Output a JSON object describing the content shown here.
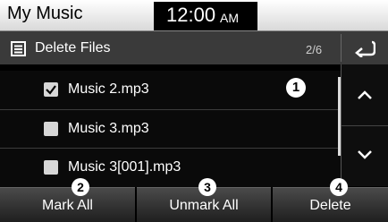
{
  "status": {
    "app_title": "My Music",
    "time": "12:00",
    "ampm": "AM"
  },
  "header": {
    "icon": "list-icon",
    "title": "Delete Files",
    "page_counter": "2/6",
    "back_icon": "back-arrow-icon"
  },
  "files": [
    {
      "name": "Music 2.mp3",
      "checked": true
    },
    {
      "name": "Music 3.mp3",
      "checked": false
    },
    {
      "name": "Music 3[001].mp3",
      "checked": false
    }
  ],
  "annotations": {
    "list": "1",
    "mark_all": "2",
    "unmark_all": "3",
    "delete": "4"
  },
  "scroll": {
    "up_icon": "chevron-up-icon",
    "down_icon": "chevron-down-icon"
  },
  "buttons": {
    "mark_all": "Mark All",
    "unmark_all": "Unmark All",
    "delete": "Delete"
  }
}
